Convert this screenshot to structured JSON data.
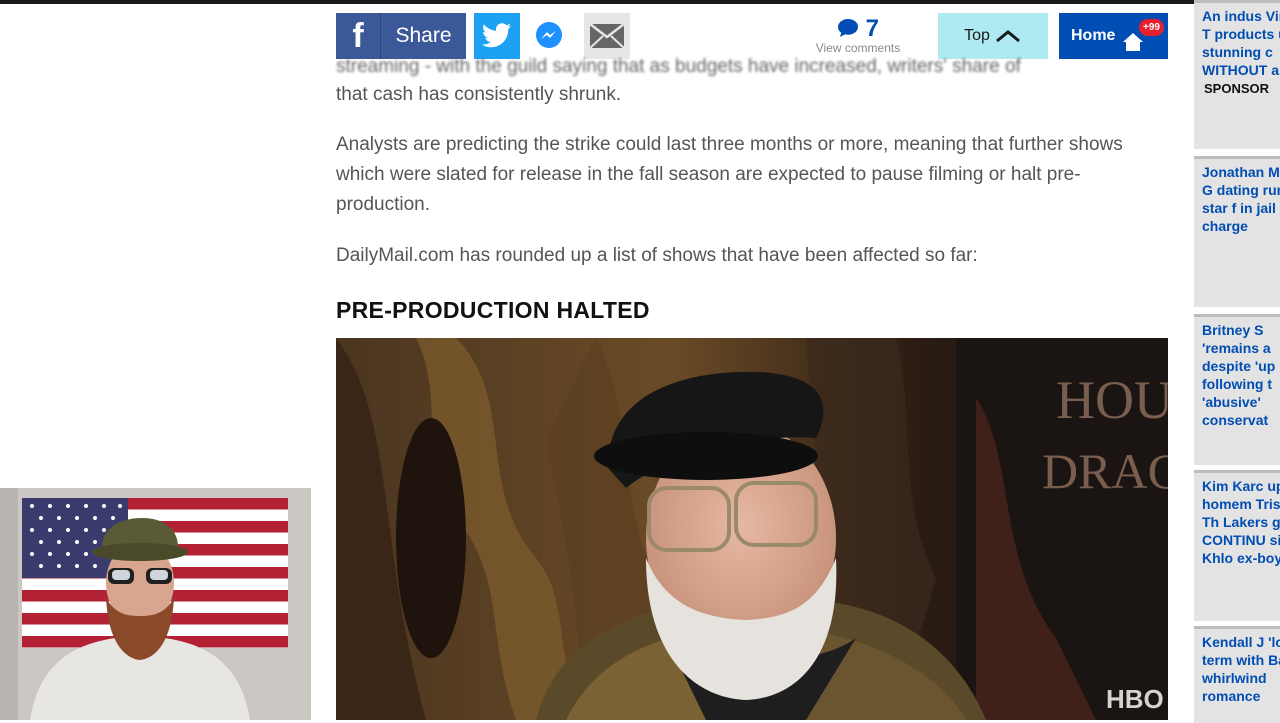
{
  "share": {
    "facebook_label": "Share",
    "comments_count": "7",
    "comments_label": "View comments",
    "top_label": "Top",
    "home_label": "Home",
    "home_badge": "+99"
  },
  "article": {
    "cut_line": "streaming - with the guild saying that as budgets have increased, writers' share of",
    "para1": "that cash has consistently shrunk.",
    "para2": "Analysts are predicting the strike could last three months or more, meaning that further shows which were slated for release in the fall season are expected to pause filming or halt pre-production.",
    "para3": "DailyMail.com has rounded up a list of shows that have been affected so far:",
    "heading": "PRE-PRODUCTION HALTED",
    "photo_sign_line1": "HOUSE",
    "photo_sign_line2": "DRAGON",
    "photo_logo": "HBO"
  },
  "sidebar": {
    "items": [
      {
        "text": "An indus Virtually T products u stunning c WITHOUT article",
        "sponsor": "SPONSOR"
      },
      {
        "text": "Jonathan Meagan G dating rum Man star f in jail for h charge"
      },
      {
        "text": "Britney S 'remains a despite 'up following t 'abusive' conservat"
      },
      {
        "text": "Kim Karc up homem Tristan Th Lakers ga CONTINU sister Khlo ex-boyfrie"
      },
      {
        "text": "Kendall J 'long-term with Bad B whirlwind romance"
      }
    ]
  },
  "colors": {
    "facebook": "#3b5998",
    "twitter": "#1da1f2",
    "home": "#004db3",
    "top": "#aeeaf2",
    "link": "#004db3"
  }
}
